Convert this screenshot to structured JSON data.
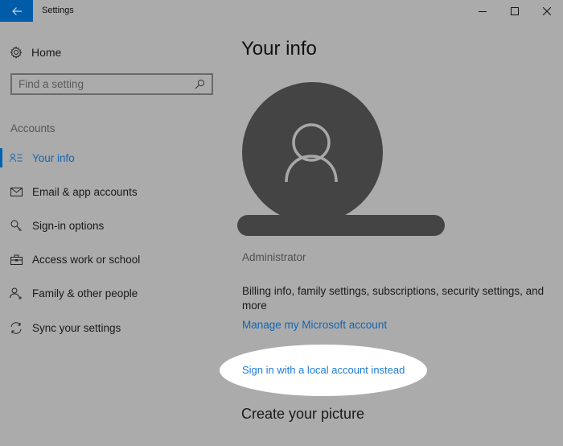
{
  "window": {
    "title": "Settings",
    "accent_color": "#005ca8",
    "controls": [
      "minimize-icon",
      "maximize-icon",
      "close-icon"
    ]
  },
  "sidebar": {
    "home_label": "Home",
    "home_icon": "gear-icon",
    "search_placeholder": "Find a setting",
    "section_label": "Accounts",
    "items": [
      {
        "label": "Your info",
        "icon": "contact-info-icon",
        "active": true
      },
      {
        "label": "Email & app accounts",
        "icon": "mail-icon",
        "active": false
      },
      {
        "label": "Sign-in options",
        "icon": "key-icon",
        "active": false
      },
      {
        "label": "Access work or school",
        "icon": "briefcase-icon",
        "active": false
      },
      {
        "label": "Family & other people",
        "icon": "add-person-icon",
        "active": false
      },
      {
        "label": "Sync your settings",
        "icon": "sync-icon",
        "active": false
      }
    ]
  },
  "main": {
    "title": "Your info",
    "role": "Administrator",
    "description": "Billing info, family settings, subscriptions, security settings, and more",
    "manage_link": "Manage my Microsoft account",
    "local_account_link": "Sign in with a local account instead",
    "create_picture_heading": "Create your picture",
    "link_color": "#1565b0"
  }
}
